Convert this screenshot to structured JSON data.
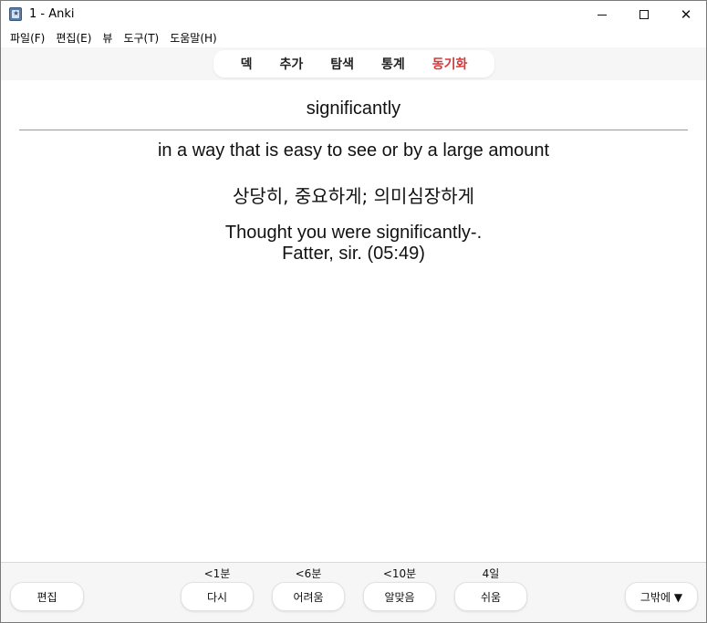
{
  "window": {
    "title": "1 - Anki",
    "minimize_glyph": "",
    "close_glyph": "✕"
  },
  "menu": {
    "items": [
      "파일(F)",
      "편집(E)",
      "뷰",
      "도구(T)",
      "도움말(H)"
    ]
  },
  "toolbar": {
    "items": [
      "덱",
      "추가",
      "탐색",
      "통계",
      "동기화"
    ],
    "sync_color": "#d23a3a"
  },
  "card": {
    "front": "significantly",
    "definition": "in a way that is easy to see or by a large amount",
    "korean": "상당히, 중요하게; 의미심장하게",
    "example_line1": "Thought you were significantly-.",
    "example_line2": "Fatter, sir. (05:49)"
  },
  "bottom": {
    "edit_label": "편집",
    "more_label": "그밖에 ▼",
    "answers": [
      {
        "interval": "<1분",
        "label": "다시"
      },
      {
        "interval": "<6분",
        "label": "어려움"
      },
      {
        "interval": "<10분",
        "label": "알맞음"
      },
      {
        "interval": "4일",
        "label": "쉬움"
      }
    ]
  }
}
